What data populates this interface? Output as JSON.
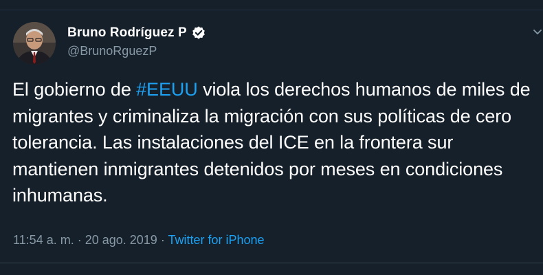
{
  "author": {
    "display_name": "Bruno Rodríguez P",
    "handle": "@BrunoRguezP",
    "verified": true
  },
  "tweet": {
    "text_before_hashtag": "El gobierno de ",
    "hashtag": "#EEUU",
    "text_after_hashtag": " viola los derechos humanos de miles de migrantes y criminaliza la migración con sus políticas de cero tolerancia. Las instalaciones del ICE en la frontera sur mantienen inmigrantes detenidos por meses en condiciones inhumanas."
  },
  "meta": {
    "time": "11:54 a. m.",
    "separator_1": " · ",
    "date": "20 ago. 2019",
    "separator_2": " · ",
    "source": "Twitter for iPhone"
  },
  "icons": {
    "verified": "verified-badge-icon",
    "menu": "chevron-down-icon"
  },
  "colors": {
    "background": "#15202b",
    "link": "#1da1f2",
    "secondary_text": "#8899a6",
    "primary_text": "#ffffff"
  }
}
